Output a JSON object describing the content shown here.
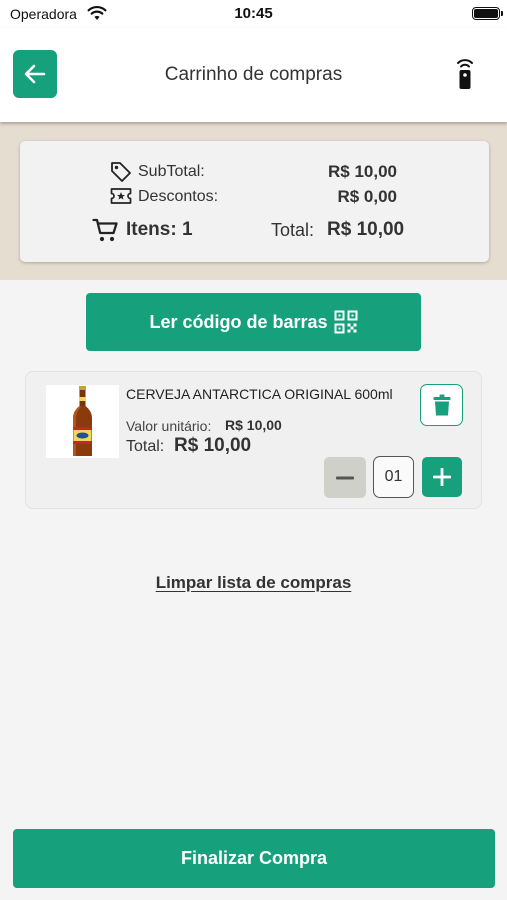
{
  "status_bar": {
    "carrier": "Operadora",
    "time": "10:45",
    "wifi_icon": "wifi-icon",
    "battery_icon": "battery-icon"
  },
  "navbar": {
    "title": "Carrinho de compras",
    "back_icon": "arrow-left-icon",
    "remote_icon": "remote-control-icon"
  },
  "summary": {
    "subtotal_label": "SubTotal:",
    "subtotal_value": "R$ 10,00",
    "discount_label": "Descontos:",
    "discount_value": "R$ 0,00",
    "items_label": "Itens: 1",
    "total_label": "Total:",
    "total_value": "R$ 10,00"
  },
  "scan_button": {
    "label": "Ler código de barras",
    "icon": "qr-code-icon"
  },
  "cart_items": [
    {
      "name": "CERVEJA ANTARCTICA ORIGINAL 600ml",
      "unit_label": "Valor unitário:",
      "unit_value": "R$ 10,00",
      "total_label": "Total:",
      "total_value": "R$ 10,00",
      "quantity": "01",
      "image": "beer-bottle-image"
    }
  ],
  "clear_link": "Limpar lista de compras",
  "finish_button": "Finalizar Compra",
  "colors": {
    "accent": "#16a07c",
    "band": "#e5ddd0",
    "background": "#f4f4f4",
    "minus_button": "#d0d0cb"
  }
}
